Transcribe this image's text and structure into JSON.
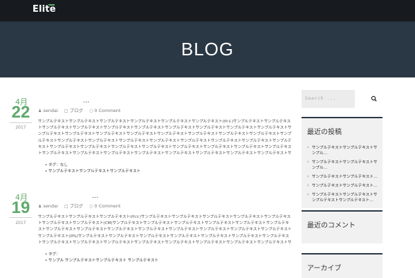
{
  "header": {
    "logo": "Elite"
  },
  "hero": {
    "title": "BLOG"
  },
  "posts": [
    {
      "month": "4月",
      "day": "22",
      "year": "2017",
      "title": "…",
      "author": "sendai",
      "category": "ブログ",
      "comments": "0 Comment",
      "body": "サンプルテキストサンプルテキストサンプルテキストサンプルテキストサンプルテキストサンプルテキスト(ｍｓ)サンプルテキストサンプルテキストサンプルテキストサンプルテキストサンプルテキストサンプルテキストサンプルテキストサンプルテキストサンプルテキストサンプルテキストサンプルテキストサンプルテキストサンプルテキストサンプルテキストサンプルテキストサンプルテキストサンプルテキストサンプルテキストサンプルテキストサンプルテキストサンプルテキストサンプルテキストサンプルテキストサンプルテキストサンプルテキストサンプルテキストサンプルテキストサンプルテキストサンプルテキストサンプルテキストサンプルテキストサンプルテキストサンプルテキストサンプルテキストサンプルテキストサンプルテキストサンプルテキストサンプルテキストサンプルテキストサンプルテキストサンプルテキストサンプルテキストサンプルテキストサンプルテキストサンプルテキストサンプルテキスト(CM)サンプルテキストサンプルテキストサンプルテキストサンプルテキストサンプルテキストサンプルテキストサンプルテキストサンプル",
      "tag_label": "タグ：なし",
      "link_text": "サンプルテキストサンプルテキストサンプルテキスト"
    },
    {
      "month": "4月",
      "day": "19",
      "year": "2017",
      "title": "…",
      "author": "sendai",
      "category": "ブログ",
      "comments": "0 Comment",
      "body": "サンプルテキストサンプルテキストサンプルテキスト(ｍｓ)サンプルテキストサンプルテキストサンプルテキストサンプルテキストサンプルテキストサンプルテキストサンプルテキスト(CM)サンプルテキストサンプルテキストサンプルテキストサンプルテキストサンプルテキストサンプルテキストサンプルテキストサンプルテキストサンプルテキストサンプルテキストサンプルテキストサンプルテキストサンプルテキストサンプルテキストサンプルテキスト(0%)サンプルテキストサンプルテキストサンプルテキストサンプルテキストサンプルテキストサンプルテキストサンプルテキストサンプルテキストサンプルテキストサンプルテキストサンプルテキストサンプルテキストサンプルテキストサンプルテキストサンプルテキストサンプルテキストサンプルテキストサンプルテキストサンプルテキスト",
      "tag_label": "タグ：",
      "link_text": "サンプル サンプルテキストサンプルテキスト サンプルテキスト"
    }
  ],
  "sidebar": {
    "search_placeholder": "Search ...",
    "widgets": [
      {
        "title": "最近の投稿",
        "items": [
          "サンプルテキストサンプルテキストサンプル…",
          "サンプルテキストサンプルテキストサンプル…",
          "サンプルテキストサンプルテキスト…",
          "サンプルテキストサンプルテキスト…",
          "サンプルテキストサンプルテキストサンプルテキストサンプルテキスト…"
        ]
      },
      {
        "title": "最近のコメント",
        "items": []
      },
      {
        "title": "アーカイブ",
        "items": []
      }
    ]
  },
  "colors": {
    "accent": "#5fa86a",
    "hero_bg": "#2a3744",
    "topbar_bg": "#171b1f"
  }
}
